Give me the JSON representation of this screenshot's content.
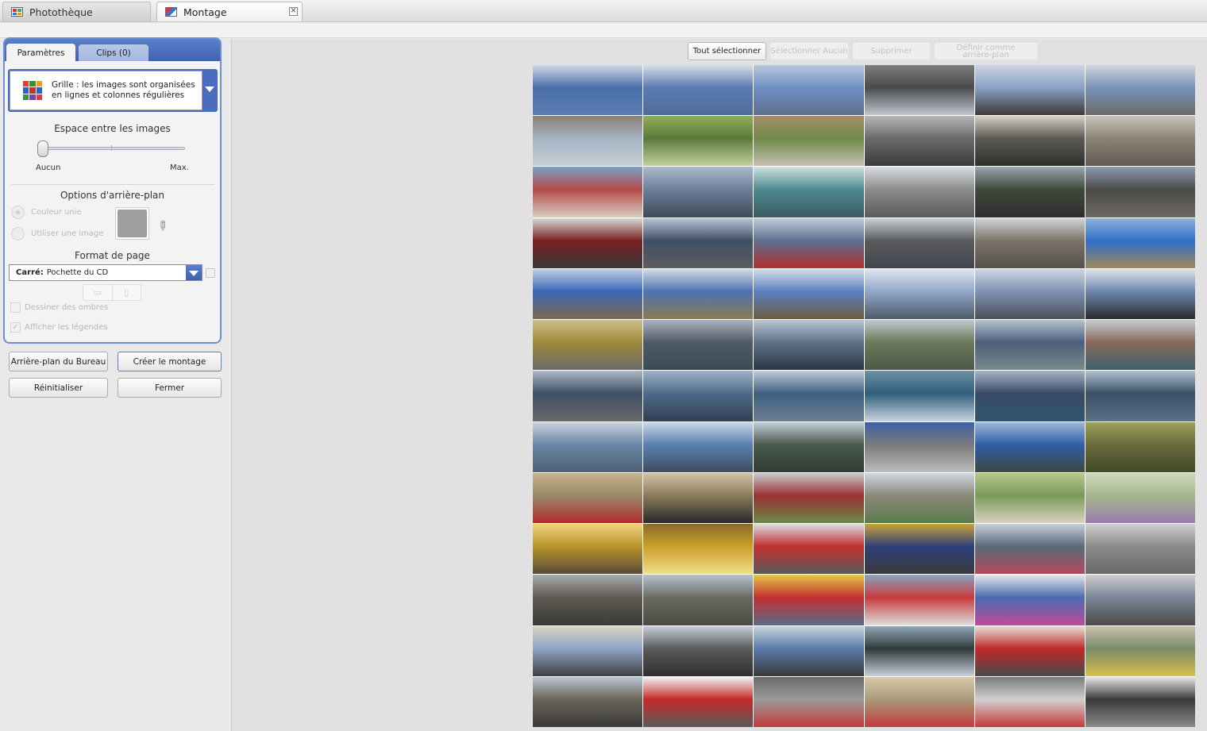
{
  "tabs": [
    {
      "label": "Photothèque",
      "icon": "library-icon",
      "active": false
    },
    {
      "label": "Montage",
      "icon": "montage-icon",
      "active": true
    }
  ],
  "panel": {
    "tabs": {
      "settings": "Paramètres",
      "clips": "Clips (0)"
    },
    "layout": {
      "text": "Grille : les images sont organisées en lignes et colonnes régulières",
      "colors": [
        "#e23b3b",
        "#3a8f3a",
        "#e8a021",
        "#2f62c8",
        "#c9302c",
        "#2f62c8",
        "#3a8f3a",
        "#7a3fb0",
        "#e23b3b"
      ]
    },
    "spacing": {
      "title": "Espace entre les images",
      "min_label": "Aucun",
      "max_label": "Max.",
      "value": 0
    },
    "background": {
      "title": "Options d'arrière-plan",
      "solid_color": "Couleur unie",
      "use_image": "Utiliser une image",
      "color": "#9e9e9e"
    },
    "page_format": {
      "title": "Format de page",
      "type_label": "Carré:",
      "value": "Pochette du CD"
    },
    "shadows_label": "Dessiner des ombres",
    "captions_label": "Afficher les légendes",
    "captions_checked": true
  },
  "buttons": {
    "desktop_bg": "Arrière-plan du Bureau",
    "create": "Créer le montage",
    "reset": "Réinitialiser",
    "close": "Fermer"
  },
  "actions": {
    "select_all": "Tout sélectionner",
    "select_none": "Sélectionner Aucun",
    "delete": "Supprimer",
    "set_background": "Définir comme arrière-plan"
  },
  "montage": {
    "columns": 6,
    "rows": 13,
    "palette": [
      [
        "#4b6fa8",
        "#cfd8e6",
        "#5a7db3"
      ],
      [
        "#5b7bb0",
        "#d8dee8",
        "#4f6d9c"
      ],
      [
        "#6f8fc4",
        "#b9c8dd",
        "#5d6f8a"
      ],
      [
        "#4a4a4a",
        "#7d7d7d",
        "#bfc6cf"
      ],
      [
        "#8aa0c4",
        "#cbd5e4",
        "#3a3a3a"
      ],
      [
        "#7892b8",
        "#d0d6de",
        "#6a6a6a"
      ],
      [
        "#a6b3c4",
        "#8a7f73",
        "#c9cfd6"
      ],
      [
        "#5a7a3a",
        "#8fae5c",
        "#c4cfa0"
      ],
      [
        "#6e8a4a",
        "#a88c6a",
        "#c7c0b0"
      ],
      [
        "#6a6a6a",
        "#b7b7b7",
        "#3c3c3c"
      ],
      [
        "#5c5a52",
        "#d4d0c6",
        "#2f2f2f"
      ],
      [
        "#8b8578",
        "#c9c4b8",
        "#605a50"
      ],
      [
        "#b44a4a",
        "#7aa0c8",
        "#d8cfc0"
      ],
      [
        "#6c7f99",
        "#aab9cc",
        "#3e4a58"
      ],
      [
        "#4e8a90",
        "#cfe2e0",
        "#3a5a60"
      ],
      [
        "#8c8c8c",
        "#d9dde2",
        "#5a5a5a"
      ],
      [
        "#3d4a3a",
        "#9aa6b2",
        "#2e2e2e"
      ],
      [
        "#4a4a4a",
        "#8d9cb0",
        "#6e6a60"
      ],
      [
        "#7a1f1f",
        "#d9d9d9",
        "#3a3a3a"
      ],
      [
        "#3f4f68",
        "#b8c4d4",
        "#5c5c5c"
      ],
      [
        "#5b6f8f",
        "#c1ccd9",
        "#b03030"
      ],
      [
        "#5a5a5a",
        "#c7d0da",
        "#40464f"
      ],
      [
        "#7b7468",
        "#cfd3d8",
        "#55504a"
      ],
      [
        "#2f6fc8",
        "#8fb2e0",
        "#a0885a"
      ],
      [
        "#3a66b8",
        "#c2cfe3",
        "#7a6a4a"
      ],
      [
        "#4f72b0",
        "#d3dbe6",
        "#8a7a54"
      ],
      [
        "#5a80c0",
        "#d6dee9",
        "#6b5c40"
      ],
      [
        "#8fa7c9",
        "#dfe5ee",
        "#4d5a6a"
      ],
      [
        "#7d93b3",
        "#cdd6e2",
        "#4a4f57"
      ],
      [
        "#6e86ad",
        "#dde3ec",
        "#2a2a2a"
      ],
      [
        "#a08a3a",
        "#cfc08a",
        "#6a6a6a"
      ],
      [
        "#4f5a66",
        "#aab4bf",
        "#3c4a58"
      ],
      [
        "#5e7389",
        "#bcc6d2",
        "#2c3440"
      ],
      [
        "#6a7a5a",
        "#c0c8cc",
        "#4a5a4a"
      ],
      [
        "#4a5f7a",
        "#b6c2cf",
        "#7a8a8f"
      ],
      [
        "#8a6a5a",
        "#c4ccd4",
        "#3f5f6f"
      ],
      [
        "#3d4f66",
        "#aeb9c6",
        "#6a6a6a"
      ],
      [
        "#4e6a8a",
        "#9fb3c9",
        "#2f3f52"
      ],
      [
        "#3f5f7f",
        "#c0ccda",
        "#6d7f92"
      ],
      [
        "#2f5f7a",
        "#6f8fa6",
        "#cad4de"
      ],
      [
        "#3a4a66",
        "#a8b5c6",
        "#2f5570"
      ],
      [
        "#385068",
        "#b4c0cd",
        "#5e7186"
      ],
      [
        "#6a86a6",
        "#c9d4df",
        "#4f6072"
      ],
      [
        "#5a7fb2",
        "#cdd8e5",
        "#3e4c5c"
      ],
      [
        "#4a5a50",
        "#c5ced9",
        "#2f3b33"
      ],
      [
        "#7a7a7a",
        "#3e5fa8",
        "#bcbcbc"
      ],
      [
        "#2f5ea8",
        "#9fb7d8",
        "#3c4a3c"
      ],
      [
        "#6a6a3a",
        "#9aa25a",
        "#3f4a2a"
      ],
      [
        "#9a8a6a",
        "#c8b48a",
        "#b02a2a"
      ],
      [
        "#8a7a5a",
        "#d0c4a6",
        "#2a2a2a"
      ],
      [
        "#9a3030",
        "#c7ccd0",
        "#6a8a4a"
      ],
      [
        "#8a8a7a",
        "#cfd8e0",
        "#5a7a4a"
      ],
      [
        "#7a9a5a",
        "#b5c98a",
        "#d9d2c0"
      ],
      [
        "#a6b88a",
        "#cfd6c0",
        "#9a7ab0"
      ],
      [
        "#b8962a",
        "#f0d27a",
        "#5a4a3a"
      ],
      [
        "#c9a02a",
        "#8a6a2a",
        "#f2dc8a"
      ],
      [
        "#c43030",
        "#d9dde2",
        "#5a5a5a"
      ],
      [
        "#2f3f7a",
        "#c9a33a",
        "#3a3a3a"
      ],
      [
        "#5a6a7a",
        "#c7cfd8",
        "#b04a5a"
      ],
      [
        "#8a8a8a",
        "#cfcfcf",
        "#6a6a6a"
      ],
      [
        "#5f5a52",
        "#a8acb2",
        "#3a3a3a"
      ],
      [
        "#6a6a62",
        "#b6c3d0",
        "#4a4a44"
      ],
      [
        "#c23030",
        "#e6c94a",
        "#5a6a8a"
      ],
      [
        "#c83a3a",
        "#8aa4c4",
        "#dfdfdf"
      ],
      [
        "#4a6ab0",
        "#e8e8e8",
        "#c04a9a"
      ],
      [
        "#7a8698",
        "#cfcfcf",
        "#4a4a4a"
      ],
      [
        "#8ea4c4",
        "#d8d2c4",
        "#3f3f3f"
      ],
      [
        "#5a5a5a",
        "#c5cfd9",
        "#2f2f2f"
      ],
      [
        "#5a7aa8",
        "#c9d3de",
        "#3a3a3a"
      ],
      [
        "#2f3a3a",
        "#8fa7b8",
        "#c5d0da"
      ],
      [
        "#c02828",
        "#e6e0d6",
        "#4a4a4a"
      ],
      [
        "#7a8a6a",
        "#c9c2ad",
        "#d8c04a"
      ],
      [
        "#6a6458",
        "#b9c6d3",
        "#3a3a3a"
      ],
      [
        "#c42a2a",
        "#f2f2f2",
        "#5a5a5a"
      ],
      [
        "#9a9a9a",
        "#6a6a6a",
        "#c43a3a"
      ],
      [
        "#a89a7a",
        "#d8caa8",
        "#c43a3a"
      ],
      [
        "#d0d0d0",
        "#7a7a7a",
        "#c43a3a"
      ],
      [
        "#3a3a3a",
        "#e6e6e6",
        "#8a8a8a"
      ]
    ]
  }
}
